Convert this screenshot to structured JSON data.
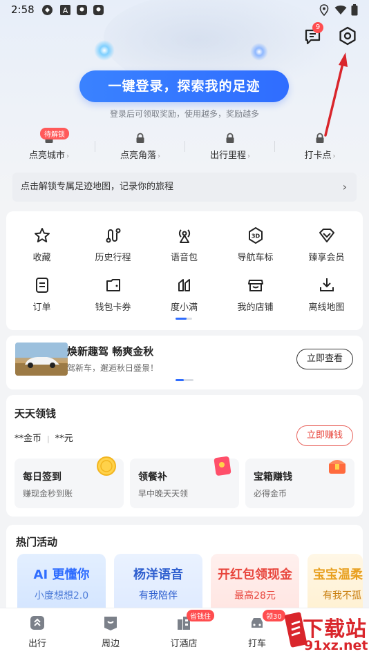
{
  "status_bar": {
    "time": "2:58",
    "left_icons": [
      "sync-icon",
      "app-a-icon",
      "maps-icon",
      "maps-icon"
    ],
    "right_icons": [
      "location-icon",
      "wifi-icon",
      "battery-icon"
    ]
  },
  "header": {
    "message_badge": "9",
    "login_button": "一键登录，探索我的足迹",
    "login_subtitle": "登录后可领取奖励，使用越多，奖励越多"
  },
  "unlock_items": [
    {
      "label": "点亮城市",
      "badge": "待解锁"
    },
    {
      "label": "点亮角落",
      "badge": ""
    },
    {
      "label": "出行里程",
      "badge": ""
    },
    {
      "label": "打卡点",
      "badge": ""
    }
  ],
  "footprint_bar": {
    "text": "点击解锁专属足迹地图，记录你的旅程",
    "arrow": "›"
  },
  "grid_items": [
    {
      "label": "收藏",
      "icon": "star-icon"
    },
    {
      "label": "历史行程",
      "icon": "route-icon"
    },
    {
      "label": "语音包",
      "icon": "voice-icon"
    },
    {
      "label": "导航车标",
      "icon": "3d-icon"
    },
    {
      "label": "臻享会员",
      "icon": "diamond-icon"
    },
    {
      "label": "订单",
      "icon": "order-icon"
    },
    {
      "label": "钱包卡券",
      "icon": "wallet-icon"
    },
    {
      "label": "度小满",
      "icon": "duxiaoman-icon"
    },
    {
      "label": "我的店铺",
      "icon": "shop-icon"
    },
    {
      "label": "离线地图",
      "icon": "download-icon"
    }
  ],
  "banner": {
    "title": "焕新趣驾 畅爽金秋",
    "subtitle": "驾新车，邂逅秋日盛景！",
    "button": "立即查看"
  },
  "money": {
    "title": "天天领钱",
    "coins": "**金币",
    "cash": "**元",
    "earn_button": "立即赚钱",
    "tasks": [
      {
        "title": "每日签到",
        "subtitle": "赚现金秒到账",
        "deco": "coin-icon"
      },
      {
        "title": "领餐补",
        "subtitle": "早中晚天天领",
        "deco": "redpacket-icon"
      },
      {
        "title": "宝箱赚钱",
        "subtitle": "必得金币",
        "deco": "treasure-icon"
      }
    ]
  },
  "hot": {
    "title": "热门活动",
    "activities": [
      {
        "t1": "AI 更懂你",
        "t2": "小度想想2.0"
      },
      {
        "t1": "杨洋语音",
        "t2": "有我陪伴"
      },
      {
        "t1": "开红包领现金",
        "t2": "最高28元"
      },
      {
        "t1": "宝宝温柔",
        "t2": "有我不孤"
      }
    ]
  },
  "bottom_nav": [
    {
      "label": "出行",
      "badge": ""
    },
    {
      "label": "周边",
      "badge": ""
    },
    {
      "label": "订酒店",
      "badge": "省钱住"
    },
    {
      "label": "打车",
      "badge": "领30"
    }
  ],
  "watermark": {
    "text": "下载站",
    "url": "91xz.net"
  },
  "colors": {
    "primary": "#2f6dff",
    "badge_red": "#ff4d4f",
    "earn_red": "#e8453c",
    "annotation_arrow": "#d9252b"
  }
}
